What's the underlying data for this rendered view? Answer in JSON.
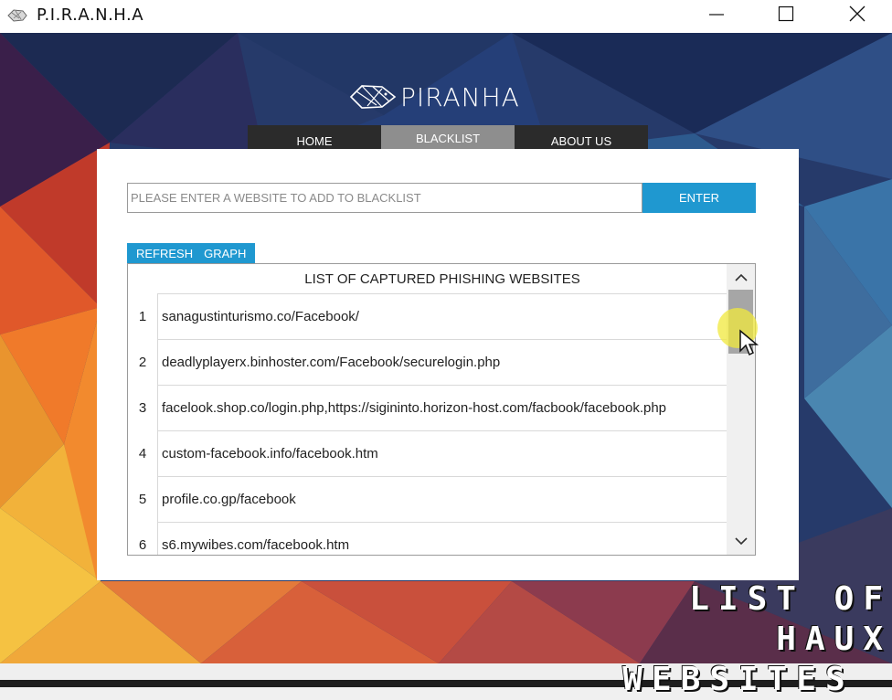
{
  "window": {
    "title": "P.I.R.A.N.H.A",
    "controls": [
      "minimize-icon",
      "maximize-icon",
      "close-icon"
    ]
  },
  "logo": {
    "text": "PIRANHA",
    "icon": "fish-icon"
  },
  "nav": {
    "tabs": [
      {
        "label": "HOME",
        "active": false
      },
      {
        "label": "BLACKLIST",
        "active": true
      },
      {
        "label": "ABOUT US",
        "active": false
      }
    ]
  },
  "blacklist": {
    "input_placeholder": "PLEASE ENTER A WEBSITE TO ADD TO BLACKLIST",
    "input_value": "",
    "enter_label": "ENTER",
    "refresh_label": "REFRESH",
    "graph_label": "GRAPH",
    "table_header": "LIST OF CAPTURED PHISHING WEBSITES",
    "rows": [
      {
        "num": "1",
        "url": "sanagustinturismo.co/Facebook/"
      },
      {
        "num": "2",
        "url": "deadlyplayerx.binhoster.com/Facebook/securelogin.php"
      },
      {
        "num": "3",
        "url": "facelook.shop.co/login.php,https://sigininto.horizon-host.com/facbook/facebook.php"
      },
      {
        "num": "4",
        "url": "custom-facebook.info/facebook.htm"
      },
      {
        "num": "5",
        "url": "profile.co.gp/facebook"
      },
      {
        "num": "6",
        "url": "s6.mywibes.com/facebook.htm"
      }
    ]
  },
  "caption": {
    "line1": "LIST OF HAUX",
    "line2": "WEBSITES"
  },
  "colors": {
    "accent": "#1f98d0",
    "nav_bg": "#2b2b2b",
    "nav_active": "#8e8e8e"
  }
}
